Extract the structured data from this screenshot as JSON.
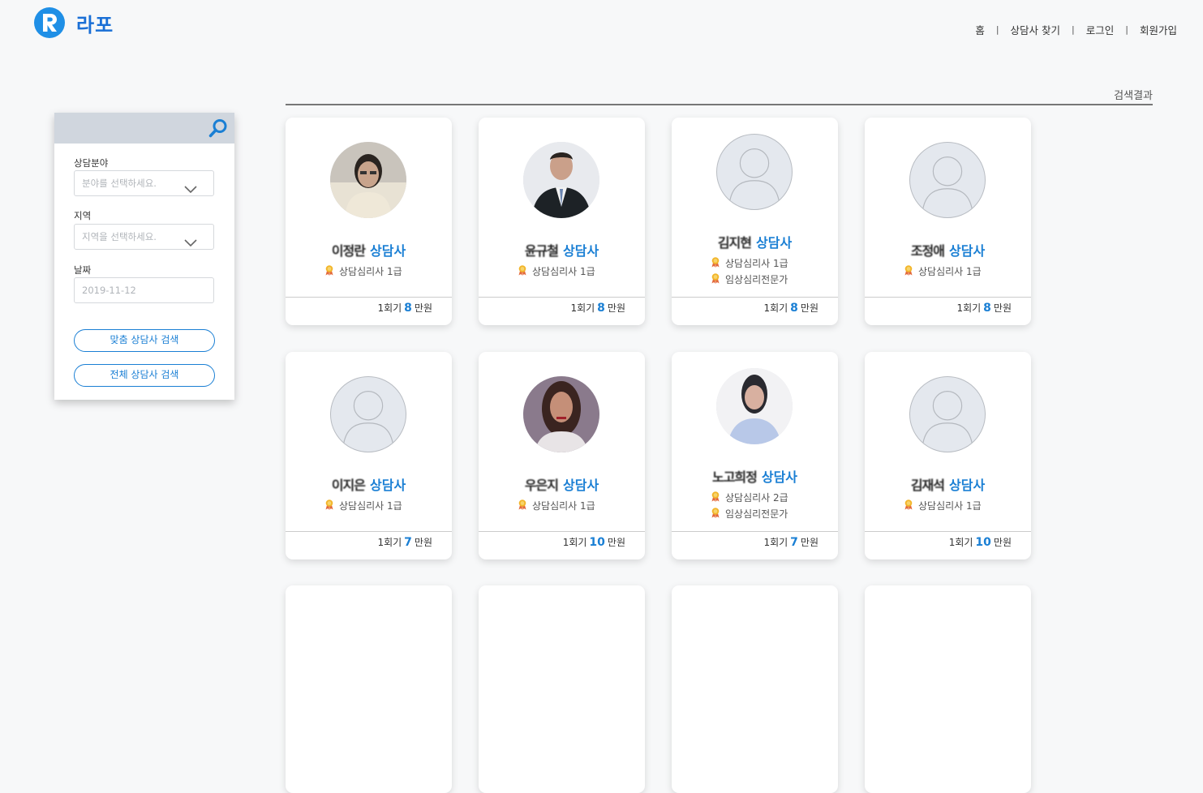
{
  "brand": {
    "name": "라포"
  },
  "nav": {
    "items": [
      "홈",
      "상담사 찾기",
      "로그인",
      "회원가입"
    ]
  },
  "search_panel": {
    "field_label": "상담분야",
    "field_placeholder": "분야를 선택하세요.",
    "region_label": "지역",
    "region_placeholder": "지역을 선택하세요.",
    "date_label": "날짜",
    "date_value": "2019-11-12",
    "custom_search_button": "맞춤 상담사 검색",
    "all_search_button": "전체 상담사 검색"
  },
  "results": {
    "title": "검색결과",
    "counselors": [
      {
        "name": "이정란",
        "role": "상담사",
        "certs": [
          "상담심리사 1급"
        ],
        "price_prefix": "1회기",
        "price": "8",
        "price_unit": "만원",
        "avatar": "photo-woman-glasses"
      },
      {
        "name": "윤규철",
        "role": "상담사",
        "certs": [
          "상담심리사 1급"
        ],
        "price_prefix": "1회기",
        "price": "8",
        "price_unit": "만원",
        "avatar": "photo-man-suit"
      },
      {
        "name": "김지현",
        "role": "상담사",
        "certs": [
          "상담심리사 1급",
          "임상심리전문가"
        ],
        "price_prefix": "1회기",
        "price": "8",
        "price_unit": "만원",
        "avatar": "placeholder"
      },
      {
        "name": "조정애",
        "role": "상담사",
        "certs": [
          "상담심리사 1급"
        ],
        "price_prefix": "1회기",
        "price": "8",
        "price_unit": "만원",
        "avatar": "placeholder"
      },
      {
        "name": "이지은",
        "role": "상담사",
        "certs": [
          "상담심리사 1급"
        ],
        "price_prefix": "1회기",
        "price": "7",
        "price_unit": "만원",
        "avatar": "placeholder"
      },
      {
        "name": "우은지",
        "role": "상담사",
        "certs": [
          "상담심리사 1급"
        ],
        "price_prefix": "1회기",
        "price": "10",
        "price_unit": "만원",
        "avatar": "photo-woman-long-hair"
      },
      {
        "name": "노고희정",
        "role": "상담사",
        "certs": [
          "상담심리사 2급",
          "임상심리전문가"
        ],
        "price_prefix": "1회기",
        "price": "7",
        "price_unit": "만원",
        "avatar": "photo-woman-blue"
      },
      {
        "name": "김재석",
        "role": "상담사",
        "certs": [
          "상담심리사 1급"
        ],
        "price_prefix": "1회기",
        "price": "10",
        "price_unit": "만원",
        "avatar": "placeholder"
      }
    ]
  }
}
